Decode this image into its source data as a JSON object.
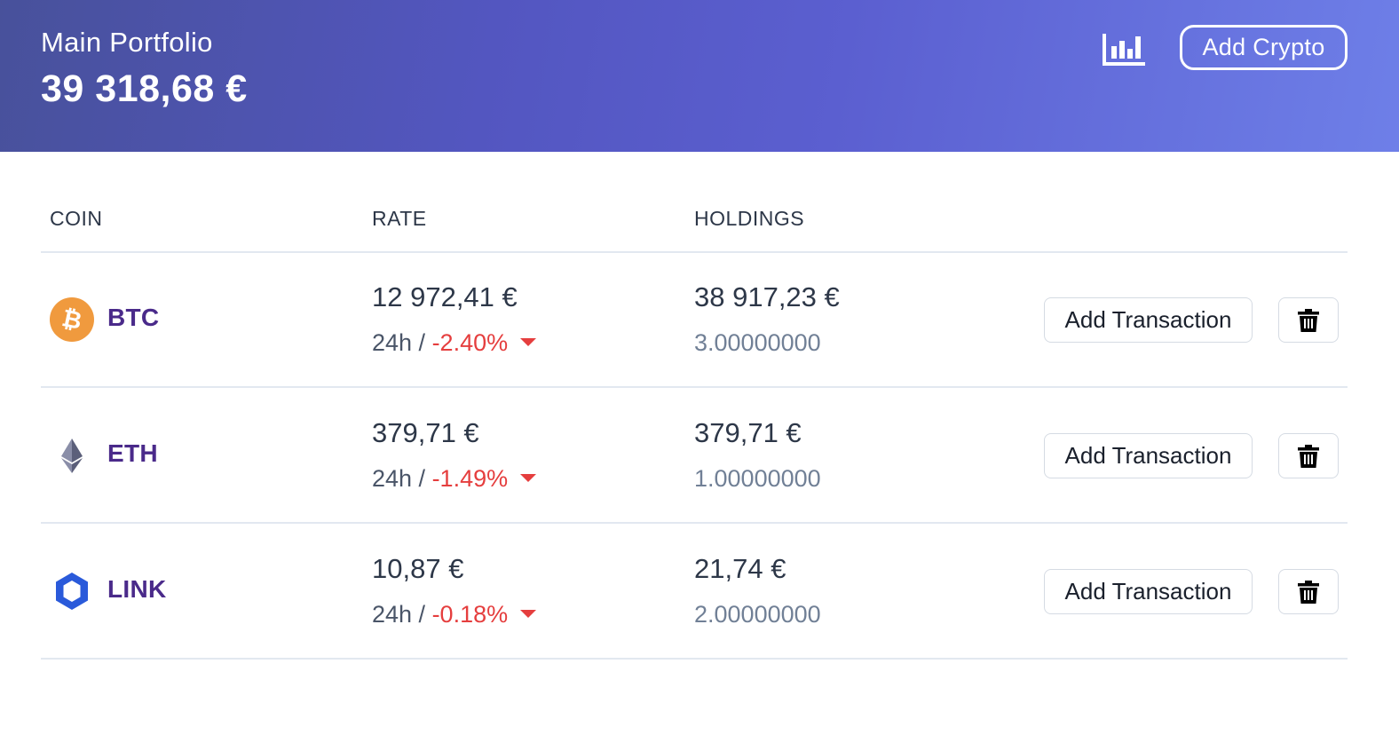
{
  "header": {
    "portfolio_name": "Main Portfolio",
    "portfolio_total": "39 318,68 €",
    "chart_icon": "bar-chart-icon",
    "add_crypto_label": "Add Crypto"
  },
  "table": {
    "columns": [
      "COIN",
      "RATE",
      "HOLDINGS"
    ],
    "rows": [
      {
        "icon": "bitcoin-icon",
        "symbol": "BTC",
        "rate": "12 972,41 €",
        "change_prefix": "24h / ",
        "change_pct": "-2.40%",
        "holdings_value": "38 917,23 €",
        "holdings_amount": "3.00000000",
        "add_tx_label": "Add Transaction",
        "delete_icon": "trash-icon"
      },
      {
        "icon": "ethereum-icon",
        "symbol": "ETH",
        "rate": "379,71 €",
        "change_prefix": "24h / ",
        "change_pct": "-1.49%",
        "holdings_value": "379,71 €",
        "holdings_amount": "1.00000000",
        "add_tx_label": "Add Transaction",
        "delete_icon": "trash-icon"
      },
      {
        "icon": "chainlink-icon",
        "symbol": "LINK",
        "rate": "10,87 €",
        "change_prefix": "24h / ",
        "change_pct": "-0.18%",
        "holdings_value": "21,74 €",
        "holdings_amount": "2.00000000",
        "add_tx_label": "Add Transaction",
        "delete_icon": "trash-icon"
      }
    ]
  },
  "colors": {
    "header_gradient_start": "#48519b",
    "header_gradient_end": "#6e7fe8",
    "coin_symbol": "#4a2a8a",
    "negative_change": "#e53e3e",
    "bitcoin": "#f09a3e",
    "chainlink": "#2a5ada"
  }
}
